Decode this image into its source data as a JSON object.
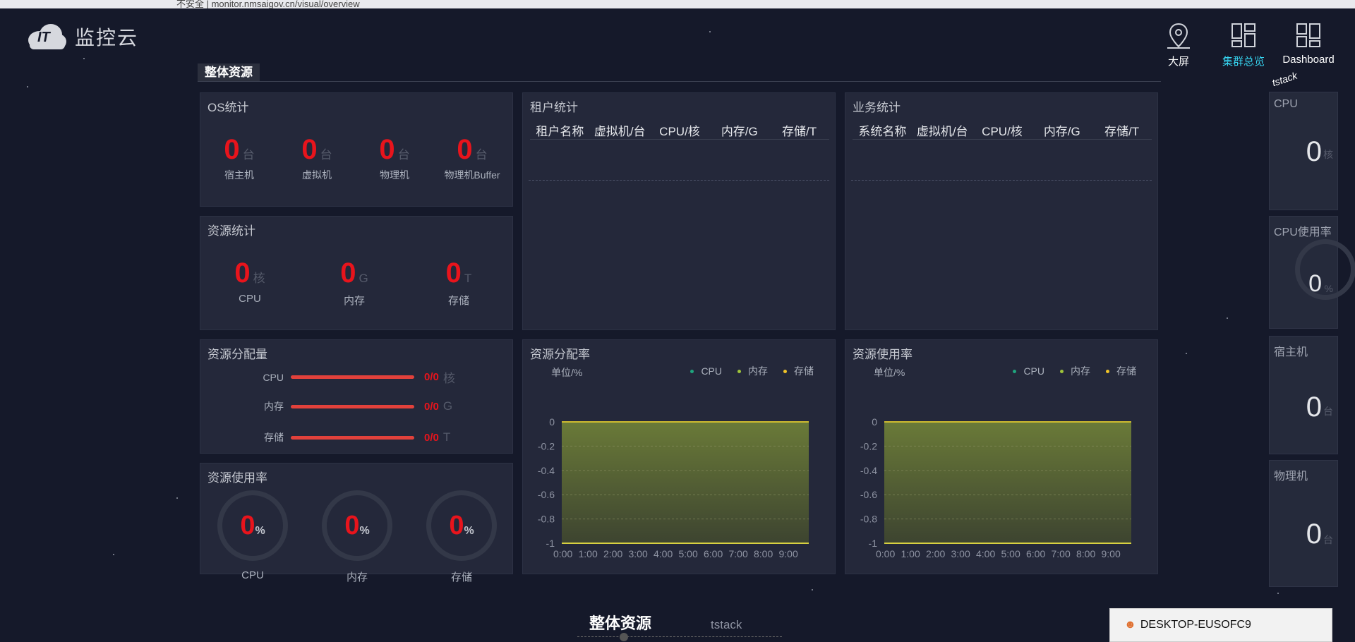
{
  "browser": {
    "url_text": "不安全 | monitor.nmsaigov.cn/visual/overview"
  },
  "app": {
    "title": "监控云",
    "logo_text": "IT"
  },
  "topnav": [
    {
      "label": "大屏",
      "icon": "location-pin-icon"
    },
    {
      "label": "集群总览",
      "icon": "grid-icon",
      "active": true
    },
    {
      "label": "Dashboard",
      "icon": "dashboard-grid-icon"
    }
  ],
  "section": {
    "title": "整体资源"
  },
  "os_stats": {
    "title": "OS统计",
    "items": [
      {
        "value": "0",
        "unit": "台",
        "label": "宿主机"
      },
      {
        "value": "0",
        "unit": "台",
        "label": "虚拟机"
      },
      {
        "value": "0",
        "unit": "台",
        "label": "物理机"
      },
      {
        "value": "0",
        "unit": "台",
        "label": "物理机Buffer"
      }
    ]
  },
  "resource_stats": {
    "title": "资源统计",
    "items": [
      {
        "value": "0",
        "unit": "核",
        "label": "CPU"
      },
      {
        "value": "0",
        "unit": "G",
        "label": "内存"
      },
      {
        "value": "0",
        "unit": "T",
        "label": "存储"
      }
    ]
  },
  "allocation": {
    "title": "资源分配量",
    "rows": [
      {
        "name": "CPU",
        "value": "0/0",
        "unit": "核"
      },
      {
        "name": "内存",
        "value": "0/0",
        "unit": "G"
      },
      {
        "name": "存储",
        "value": "0/0",
        "unit": "T"
      }
    ]
  },
  "usage_gauges": {
    "title": "资源使用率",
    "items": [
      {
        "value": "0",
        "unit": "%",
        "label": "CPU"
      },
      {
        "value": "0",
        "unit": "%",
        "label": "内存"
      },
      {
        "value": "0",
        "unit": "%",
        "label": "存储"
      }
    ]
  },
  "tenant_stats": {
    "title": "租户统计",
    "columns": [
      "租户名称",
      "虚拟机/台",
      "CPU/核",
      "内存/G",
      "存储/T"
    ]
  },
  "business_stats": {
    "title": "业务统计",
    "columns": [
      "系统名称",
      "虚拟机/台",
      "CPU/核",
      "内存/G",
      "存储/T"
    ]
  },
  "alloc_rate_chart": {
    "title": "资源分配率",
    "unit": "单位/%"
  },
  "usage_rate_chart": {
    "title": "资源使用率",
    "unit": "单位/%"
  },
  "legend": [
    {
      "name": "CPU",
      "color": "#1fa57e"
    },
    {
      "name": "内存",
      "color": "#9fc43a"
    },
    {
      "name": "存储",
      "color": "#f0c428"
    }
  ],
  "chart_data": [
    {
      "type": "area",
      "title": "资源分配率",
      "ylabel": "单位/%",
      "x": [
        "0:00",
        "1:00",
        "2:00",
        "3:00",
        "4:00",
        "5:00",
        "6:00",
        "7:00",
        "8:00",
        "9:00"
      ],
      "yticks": [
        "0",
        "-0.2",
        "-0.4",
        "-0.6",
        "-0.8",
        "-1"
      ],
      "ylim": [
        -1,
        0
      ],
      "series": [
        {
          "name": "CPU",
          "values": [
            0,
            0,
            0,
            0,
            0,
            0,
            0,
            0,
            0,
            0
          ]
        },
        {
          "name": "内存",
          "values": [
            0,
            0,
            0,
            0,
            0,
            0,
            0,
            0,
            0,
            0
          ]
        },
        {
          "name": "存储",
          "values": [
            0,
            0,
            0,
            0,
            0,
            0,
            0,
            0,
            0,
            0
          ]
        }
      ]
    },
    {
      "type": "area",
      "title": "资源使用率",
      "ylabel": "单位/%",
      "x": [
        "0:00",
        "1:00",
        "2:00",
        "3:00",
        "4:00",
        "5:00",
        "6:00",
        "7:00",
        "8:00",
        "9:00"
      ],
      "yticks": [
        "0",
        "-0.2",
        "-0.4",
        "-0.6",
        "-0.8",
        "-1"
      ],
      "ylim": [
        -1,
        0
      ],
      "series": [
        {
          "name": "CPU",
          "values": [
            0,
            0,
            0,
            0,
            0,
            0,
            0,
            0,
            0,
            0
          ]
        },
        {
          "name": "内存",
          "values": [
            0,
            0,
            0,
            0,
            0,
            0,
            0,
            0,
            0,
            0
          ]
        },
        {
          "name": "存储",
          "values": [
            0,
            0,
            0,
            0,
            0,
            0,
            0,
            0,
            0,
            0
          ]
        }
      ]
    }
  ],
  "side": {
    "header": "tstack",
    "cards": [
      {
        "title": "CPU",
        "value": "0",
        "unit": "核"
      },
      {
        "title": "CPU使用率",
        "value": "0",
        "unit": "%"
      },
      {
        "title": "宿主机",
        "value": "0",
        "unit": "台"
      },
      {
        "title": "物理机",
        "value": "0",
        "unit": "台"
      }
    ]
  },
  "carousel": {
    "current": "整体资源",
    "next": "tstack"
  },
  "taskbar": {
    "label": "DESKTOP-EUSOFC9"
  }
}
